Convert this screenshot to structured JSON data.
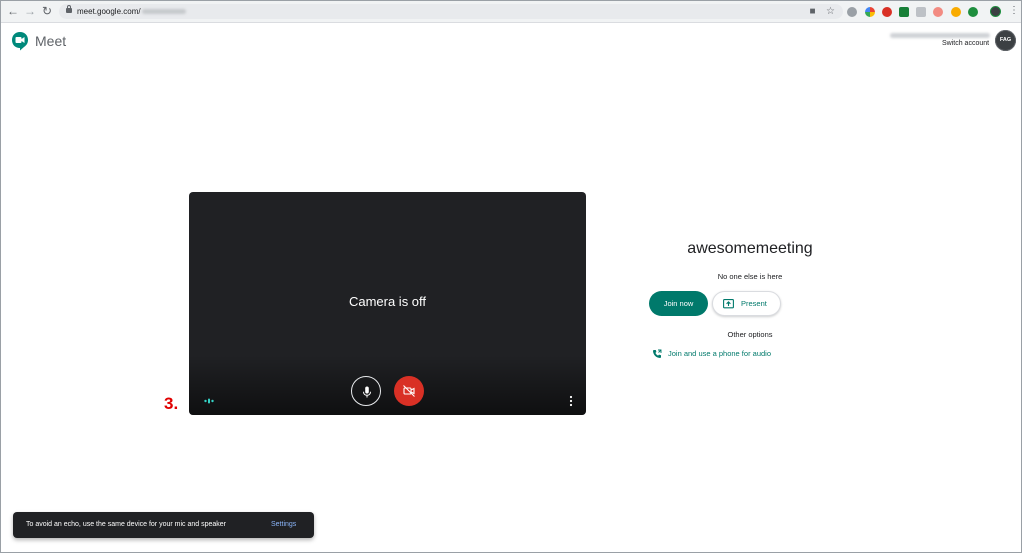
{
  "browser": {
    "url_visible": "meet.google.com/"
  },
  "header": {
    "app_name": "Meet",
    "switch_account_label": "Switch account",
    "avatar_text": "FAG"
  },
  "preview": {
    "camera_status": "Camera is off"
  },
  "annotation": {
    "step_label": "3."
  },
  "join_panel": {
    "meeting_name": "awesomemeeting",
    "status": "No one else is here",
    "join_button": "Join now",
    "present_button": "Present",
    "other_options": "Other options",
    "phone_audio_link": "Join and use a phone for audio"
  },
  "snackbar": {
    "message": "To avoid an echo, use the same device for your mic and speaker",
    "action": "Settings"
  },
  "colors": {
    "accent_teal": "#00796b",
    "camera_off_red": "#d93025",
    "preview_bg": "#202124",
    "annotation_red": "#e00000"
  }
}
